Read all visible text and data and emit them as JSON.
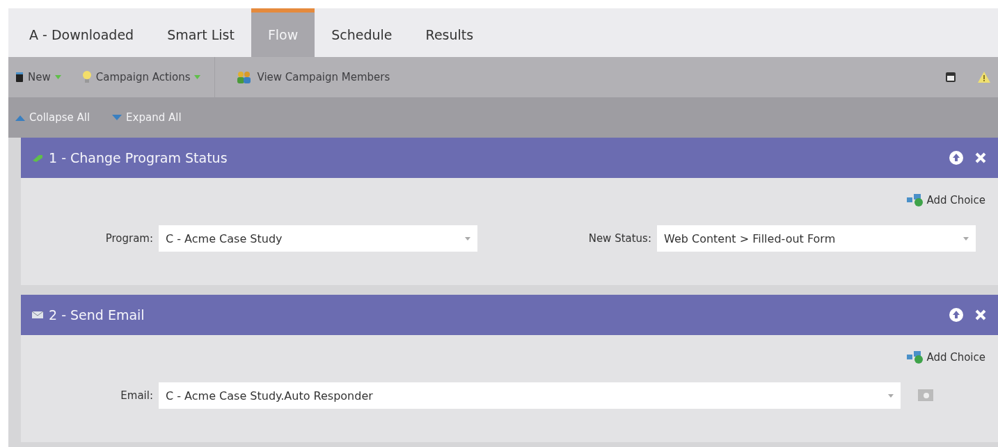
{
  "tabs": [
    {
      "label": "A - Downloaded",
      "selected": false
    },
    {
      "label": "Smart List",
      "selected": false
    },
    {
      "label": "Flow",
      "selected": true
    },
    {
      "label": "Schedule",
      "selected": false
    },
    {
      "label": "Results",
      "selected": false
    }
  ],
  "toolbar": [
    {
      "label": "New",
      "kind": "new",
      "dropdown": true
    },
    {
      "label": "Campaign Actions",
      "kind": "actions",
      "dropdown": true
    },
    {
      "label": "View Campaign Members",
      "kind": "members",
      "dropdown": false
    }
  ],
  "subtoolbar": [
    {
      "label": "Collapse All",
      "kind": "collapse"
    },
    {
      "label": "Expand All",
      "kind": "expand"
    }
  ],
  "steps": [
    {
      "title": "1 - Change Program Status",
      "kind": "status",
      "add_choice": "Add Choice",
      "fields": [
        {
          "label": "Program:",
          "value": "C - Acme Case Study",
          "preview": false
        },
        {
          "label": "New Status:",
          "value": "Web Content > Filled-out Form",
          "preview": false
        }
      ]
    },
    {
      "title": "2 - Send Email",
      "kind": "email",
      "add_choice": "Add Choice",
      "fields": [
        {
          "label": "Email:",
          "value": "C - Acme Case Study.Auto Responder",
          "preview": true
        }
      ]
    }
  ]
}
